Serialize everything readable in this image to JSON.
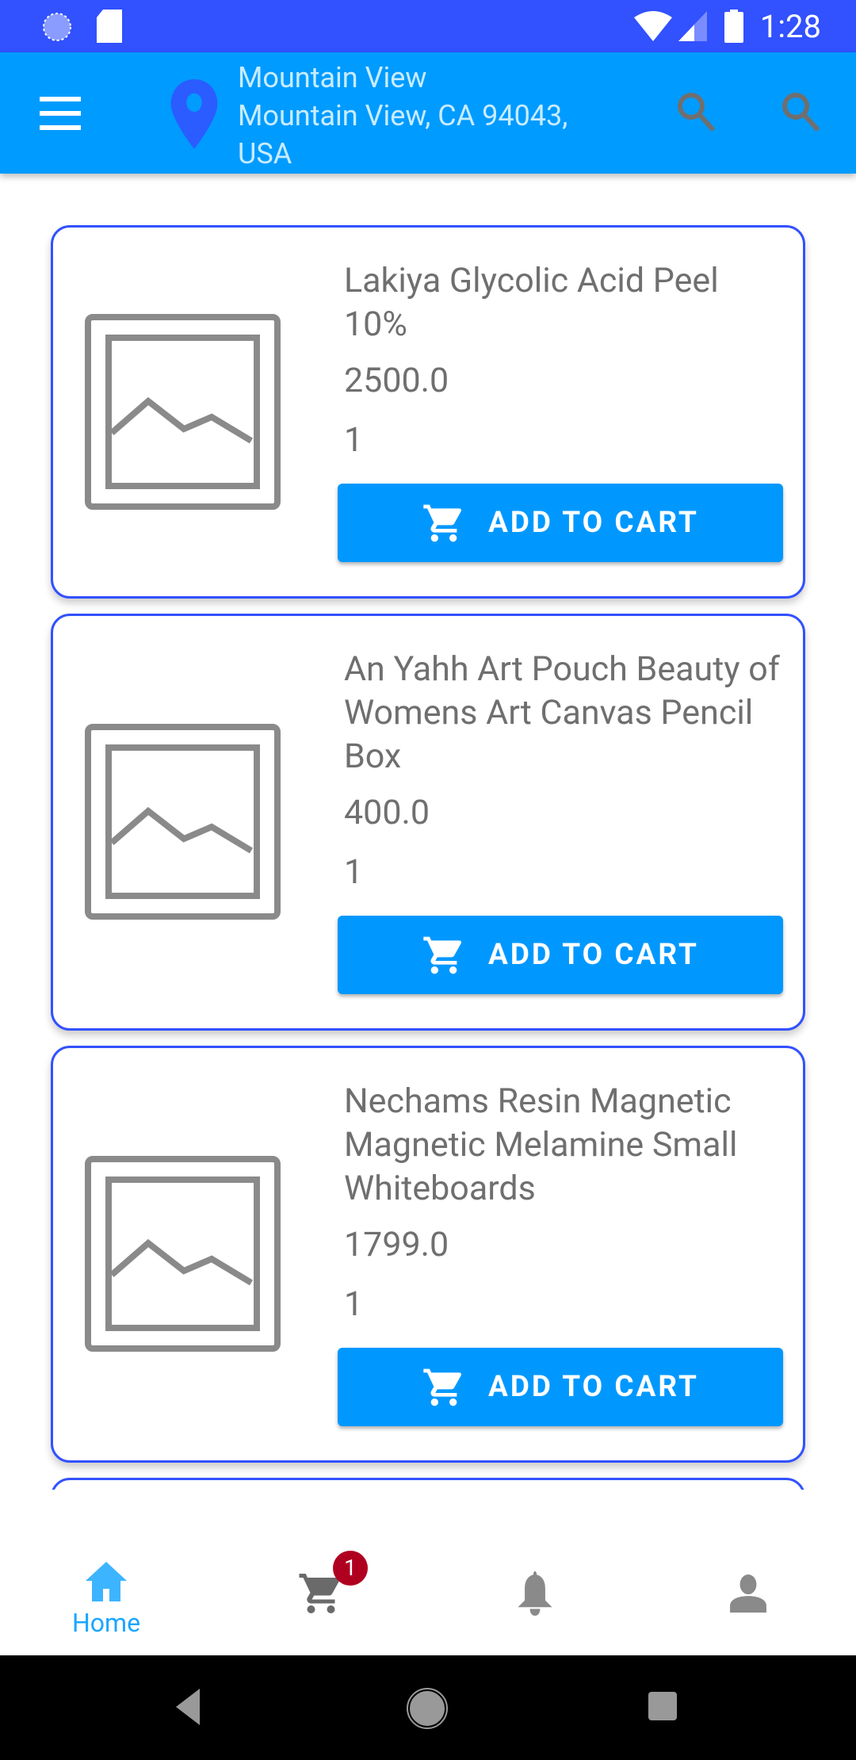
{
  "status_bar": {
    "time": "1:28"
  },
  "app_bar": {
    "location_name": "Mountain View",
    "address_line1": "Mountain View, CA 94043,",
    "address_line2": "USA"
  },
  "products": [
    {
      "title": "Lakiya Glycolic Acid Peel 10%",
      "price": "2500.0",
      "quantity": "1",
      "button": "ADD TO CART"
    },
    {
      "title": "An Yahh Art Pouch Beauty of Womens Art Canvas Pencil Box",
      "price": "400.0",
      "quantity": "1",
      "button": "ADD TO CART"
    },
    {
      "title": "Nechams Resin Magnetic Magnetic Melamine Small Whiteboards",
      "price": "1799.0",
      "quantity": "1",
      "button": "ADD TO CART"
    }
  ],
  "bottom_nav": {
    "home": "Home",
    "cart_badge": "1"
  },
  "colors": {
    "status": "#3251ff",
    "appbar": "#009bff",
    "accent": "#0098ff",
    "badge": "#b00020"
  }
}
